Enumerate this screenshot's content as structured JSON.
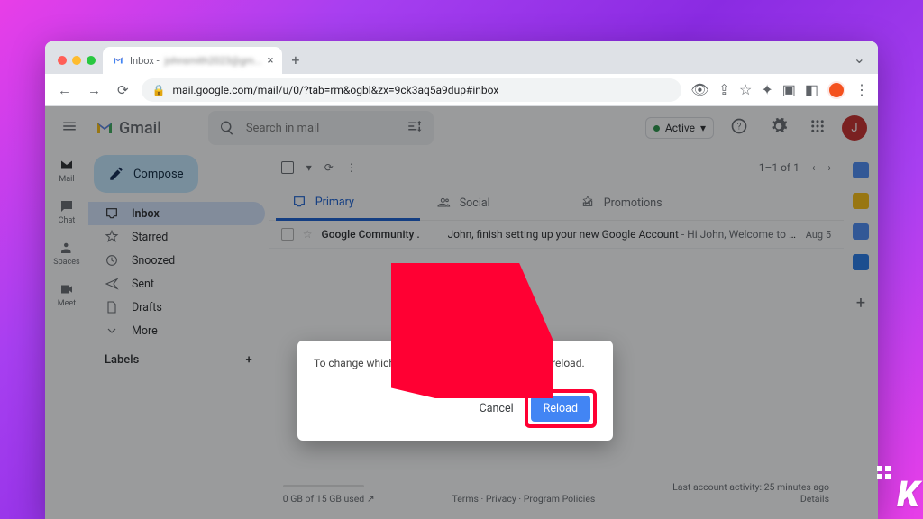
{
  "browser": {
    "tab_title": "Inbox -",
    "tab_blurred": "johnsmith2023@gm...",
    "url": "mail.google.com/mail/u/0/?tab=rm&ogbl&zx=9ck3aq5a9dup#inbox"
  },
  "header": {
    "brand": "Gmail",
    "search_placeholder": "Search in mail",
    "status": "Active",
    "avatar_letter": "J"
  },
  "rail": [
    {
      "label": "Mail"
    },
    {
      "label": "Chat"
    },
    {
      "label": "Spaces"
    },
    {
      "label": "Meet"
    }
  ],
  "compose": "Compose",
  "nav": [
    {
      "label": "Inbox",
      "selected": true,
      "icon": "inbox"
    },
    {
      "label": "Starred",
      "icon": "star"
    },
    {
      "label": "Snoozed",
      "icon": "clock"
    },
    {
      "label": "Sent",
      "icon": "send"
    },
    {
      "label": "Drafts",
      "icon": "file"
    },
    {
      "label": "More",
      "icon": "more"
    }
  ],
  "labels_heading": "Labels",
  "toolbar": {
    "page_range": "1–1 of 1"
  },
  "tabs": [
    {
      "label": "Primary",
      "active": true
    },
    {
      "label": "Social"
    },
    {
      "label": "Promotions"
    }
  ],
  "mail": [
    {
      "sender": "Google Community .",
      "subject": "John, finish setting up your new Google Account",
      "preview": " - Hi John, Welcome to G...",
      "date": "Aug 5"
    }
  ],
  "footer": {
    "storage": "0 GB of 15 GB used",
    "links": "Terms · Privacy · Program Policies",
    "activity": "Last account activity: 25 minutes ago",
    "details": "Details"
  },
  "dialog": {
    "message": "To change which apps are visible, Gmail needs to reload.",
    "cancel": "Cancel",
    "reload": "Reload"
  },
  "watermark": "K"
}
